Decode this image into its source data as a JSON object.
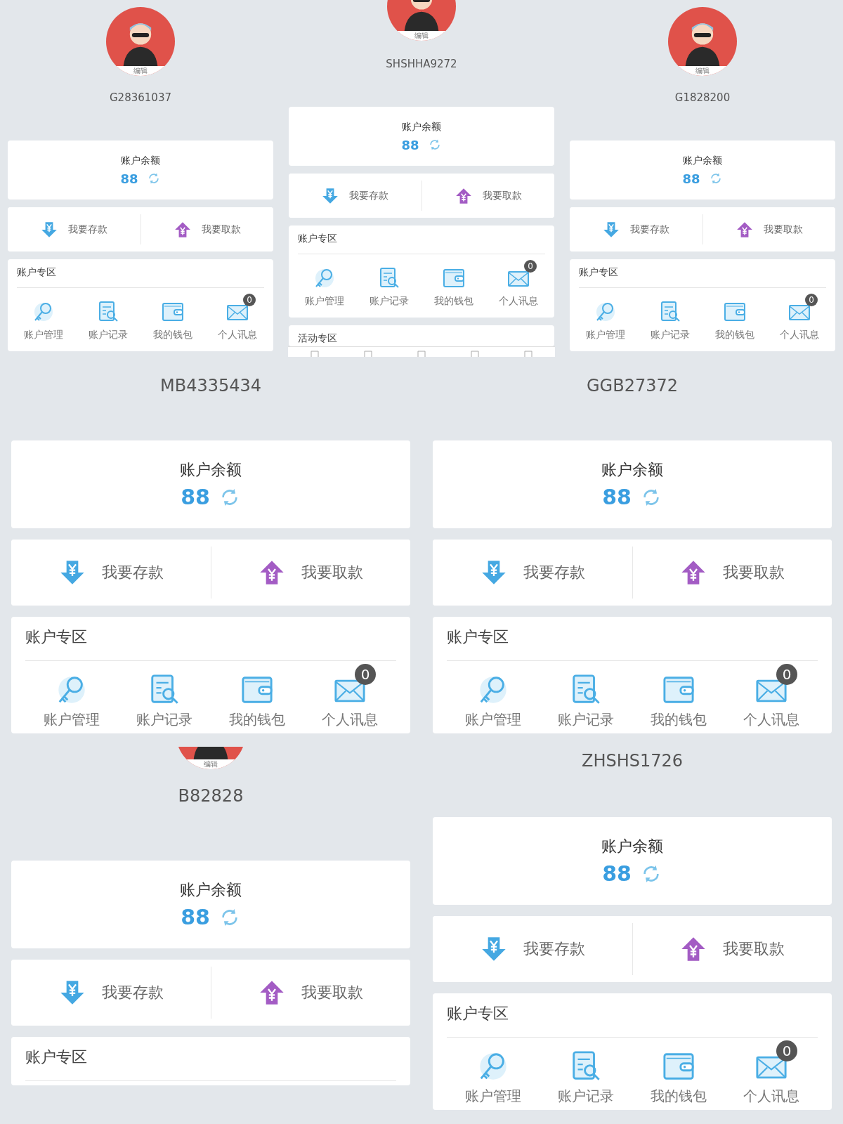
{
  "rows": [
    {
      "panels": [
        {
          "kind": "compact",
          "avatar": {
            "kind": "full",
            "edit_label": "编辑"
          },
          "username": "G28361037",
          "balance_title": "账户余额",
          "balance": "88",
          "actions": [
            {
              "kind": "deposit",
              "label": "我要存款"
            },
            {
              "kind": "withdraw",
              "label": "我要取款"
            }
          ],
          "zone": {
            "title": "账户专区",
            "items": [
              {
                "kind": "key",
                "label": "账户管理"
              },
              {
                "kind": "record",
                "label": "账户记录"
              },
              {
                "kind": "wallet",
                "label": "我的钱包"
              },
              {
                "kind": "mail",
                "label": "个人讯息",
                "badge": "0"
              }
            ]
          }
        },
        {
          "kind": "compact",
          "avatar": {
            "kind": "top-cut",
            "edit_label": "编辑"
          },
          "username": "SHSHHA9272",
          "balance_title": "账户余额",
          "balance": "88",
          "actions": [
            {
              "kind": "deposit",
              "label": "我要存款"
            },
            {
              "kind": "withdraw",
              "label": "我要取款"
            }
          ],
          "zone": {
            "title": "账户专区",
            "items": [
              {
                "kind": "key",
                "label": "账户管理"
              },
              {
                "kind": "record",
                "label": "账户记录"
              },
              {
                "kind": "wallet",
                "label": "我的钱包"
              },
              {
                "kind": "mail",
                "label": "个人讯息",
                "badge": "0"
              }
            ]
          },
          "activity_title": "活动专区",
          "nav_bar": true
        },
        {
          "kind": "compact",
          "avatar": {
            "kind": "full",
            "edit_label": "编辑"
          },
          "username": "G1828200",
          "balance_title": "账户余额",
          "balance": "88",
          "actions": [
            {
              "kind": "deposit",
              "label": "我要存款"
            },
            {
              "kind": "withdraw",
              "label": "我要取款"
            }
          ],
          "zone": {
            "title": "账户专区",
            "items": [
              {
                "kind": "key",
                "label": "账户管理"
              },
              {
                "kind": "record",
                "label": "账户记录"
              },
              {
                "kind": "wallet",
                "label": "我的钱包"
              },
              {
                "kind": "mail",
                "label": "个人讯息",
                "badge": "0"
              }
            ]
          }
        }
      ]
    },
    {
      "panels": [
        {
          "kind": "large",
          "username": "MB4335434",
          "balance_title": "账户余额",
          "balance": "88",
          "actions": [
            {
              "kind": "deposit",
              "label": "我要存款"
            },
            {
              "kind": "withdraw",
              "label": "我要取款"
            }
          ],
          "zone": {
            "title": "账户专区",
            "items": [
              {
                "kind": "key",
                "label": "账户管理"
              },
              {
                "kind": "record",
                "label": "账户记录"
              },
              {
                "kind": "wallet",
                "label": "我的钱包"
              },
              {
                "kind": "mail",
                "label": "个人讯息",
                "badge": "0"
              }
            ]
          }
        },
        {
          "kind": "large",
          "username": "GGB27372",
          "balance_title": "账户余额",
          "balance": "88",
          "actions": [
            {
              "kind": "deposit",
              "label": "我要存款"
            },
            {
              "kind": "withdraw",
              "label": "我要取款"
            }
          ],
          "zone": {
            "title": "账户专区",
            "items": [
              {
                "kind": "key",
                "label": "账户管理"
              },
              {
                "kind": "record",
                "label": "账户记录"
              },
              {
                "kind": "wallet",
                "label": "我的钱包"
              },
              {
                "kind": "mail",
                "label": "个人讯息",
                "badge": "0"
              }
            ]
          }
        }
      ]
    },
    {
      "panels": [
        {
          "kind": "large",
          "avatar": {
            "kind": "bottom-sliver",
            "edit_label": "编辑"
          },
          "username": "B82828",
          "balance_title": "账户余额",
          "balance": "88",
          "actions": [
            {
              "kind": "deposit",
              "label": "我要存款"
            },
            {
              "kind": "withdraw",
              "label": "我要取款"
            }
          ],
          "zone": {
            "title": "账户专区"
          }
        },
        {
          "kind": "large",
          "username": "ZHSHS1726",
          "balance_title": "账户余额",
          "balance": "88",
          "actions": [
            {
              "kind": "deposit",
              "label": "我要存款"
            },
            {
              "kind": "withdraw",
              "label": "我要取款"
            }
          ],
          "zone": {
            "title": "账户专区",
            "items": [
              {
                "kind": "key",
                "label": "账户管理"
              },
              {
                "kind": "record",
                "label": "账户记录"
              },
              {
                "kind": "wallet",
                "label": "我的钱包"
              },
              {
                "kind": "mail",
                "label": "个人讯息",
                "badge": "0"
              }
            ]
          }
        }
      ]
    }
  ]
}
